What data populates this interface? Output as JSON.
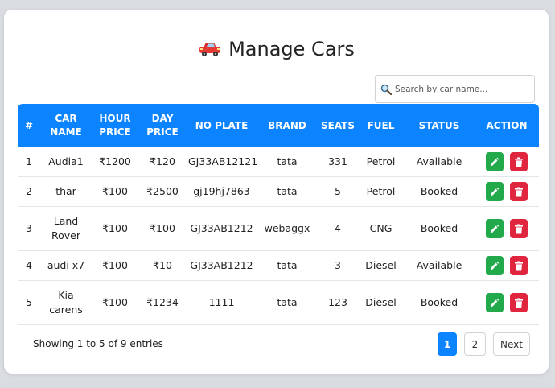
{
  "page": {
    "title": "Manage Cars",
    "title_icon": "car-icon"
  },
  "search": {
    "placeholder": "Search by car name...",
    "value": ""
  },
  "table": {
    "headers": [
      "#",
      "CAR NAME",
      "HOUR PRICE",
      "DAY PRICE",
      "NO PLATE",
      "BRAND",
      "SEATS",
      "FUEL",
      "STATUS",
      "ACTION"
    ],
    "rows": [
      {
        "no": "1",
        "name": "Audia1",
        "hour": "₹1200",
        "day": "₹120",
        "plate": "GJ33AB12121",
        "brand": "tata",
        "seats": "331",
        "fuel": "Petrol",
        "status": "Available"
      },
      {
        "no": "2",
        "name": "thar",
        "hour": "₹100",
        "day": "₹2500",
        "plate": "gj19hj7863",
        "brand": "tata",
        "seats": "5",
        "fuel": "Petrol",
        "status": "Booked"
      },
      {
        "no": "3",
        "name": "Land Rover",
        "hour": "₹100",
        "day": "₹100",
        "plate": "GJ33AB1212",
        "brand": "webaggx",
        "seats": "4",
        "fuel": "CNG",
        "status": "Booked"
      },
      {
        "no": "4",
        "name": "audi x7",
        "hour": "₹100",
        "day": "₹10",
        "plate": "GJ33AB1212",
        "brand": "tata",
        "seats": "3",
        "fuel": "Diesel",
        "status": "Available"
      },
      {
        "no": "5",
        "name": "Kia carens",
        "hour": "₹100",
        "day": "₹1234",
        "plate": "1111",
        "brand": "tata",
        "seats": "123",
        "fuel": "Diesel",
        "status": "Booked"
      }
    ],
    "action_icons": [
      "pencil-icon",
      "trash-icon"
    ]
  },
  "footer": {
    "entries_text": "Showing 1 to 5 of 9 entries",
    "pages": [
      "1",
      "2"
    ],
    "active_page": "1",
    "next_label": "Next"
  },
  "colors": {
    "header_bg": "#0d84ff",
    "edit_btn": "#22a94b",
    "delete_btn": "#e0263e",
    "active_page": "#0d84ff"
  }
}
